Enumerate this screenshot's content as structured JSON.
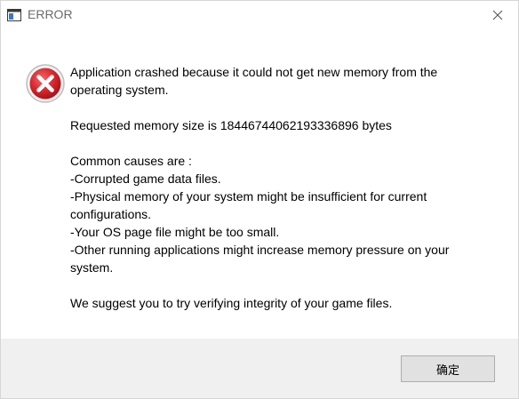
{
  "window": {
    "title": "ERROR"
  },
  "dialog": {
    "paragraphs": [
      "Application crashed because it could not get new memory from the\noperating system.",
      "Requested memory size is 18446744062193336896 bytes",
      "Common causes are :\n-Corrupted game data files.\n-Physical memory of your system might be insufficient for current\nconfigurations.\n-Your OS page file might be too small.\n-Other running applications might increase memory pressure on your\nsystem.",
      "We suggest you to try verifying integrity of your game files."
    ],
    "ok_label": "确定"
  },
  "colors": {
    "error_red": "#d8262c",
    "footer_bg": "#f0f0f0",
    "button_bg": "#e1e1e1"
  },
  "icons": {
    "app": "app-window-icon",
    "close": "close-icon",
    "error": "error-icon"
  }
}
